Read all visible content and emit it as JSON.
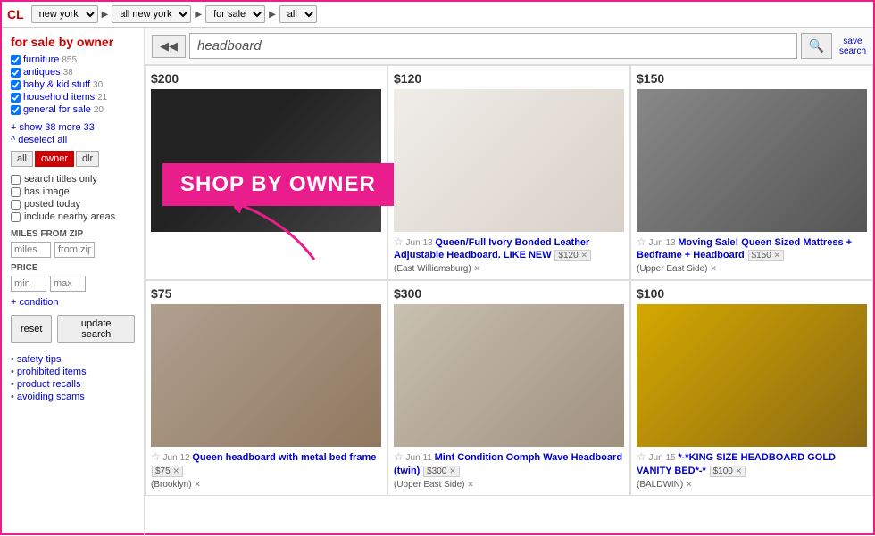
{
  "nav": {
    "logo": "CL",
    "city": "new york",
    "region": "all new york",
    "category": "for sale",
    "subcategory": "all"
  },
  "sidebar": {
    "title": "for sale by owner",
    "categories": [
      {
        "label": "furniture",
        "count": "855",
        "checked": true
      },
      {
        "label": "antiques",
        "count": "38",
        "checked": true
      },
      {
        "label": "baby & kid stuff",
        "count": "30",
        "checked": true
      },
      {
        "label": "household items",
        "count": "21",
        "checked": true
      },
      {
        "label": "general for sale",
        "count": "20",
        "checked": true
      }
    ],
    "show_more": "+ show 38 more 33",
    "deselect": "^ deselect all",
    "filter_tabs": [
      "all",
      "owner",
      "dlr"
    ],
    "active_tab": "owner",
    "filter_options": [
      {
        "label": "search titles only",
        "checked": false
      },
      {
        "label": "has image",
        "checked": false
      },
      {
        "label": "posted today",
        "checked": false
      },
      {
        "label": "include nearby areas",
        "checked": false
      }
    ],
    "miles_label": "MILES FROM ZIP",
    "miles_placeholder": "miles",
    "zip_placeholder": "from zip",
    "price_label": "PRICE",
    "price_min": "min",
    "price_max": "max",
    "condition_toggle": "+ condition",
    "btn_reset": "reset",
    "btn_update": "update search",
    "links": [
      "safety tips",
      "prohibited items",
      "product recalls",
      "avoiding scams"
    ]
  },
  "search": {
    "back_btn": "◀◀",
    "query": "headboard",
    "search_btn": "🔍",
    "save_label": "save",
    "search_label": "search"
  },
  "listings": [
    {
      "price": "$200",
      "img_class": "img-dark",
      "date": "",
      "title": "",
      "location": "",
      "tags": []
    },
    {
      "price": "$120",
      "img_class": "img-white",
      "date": "Jun 13",
      "title": "Queen/Full Ivory Bonded Leather Adjustable Headboard. LIKE NEW",
      "price_tag": "$120",
      "location": "East Williamsburg",
      "tags": []
    },
    {
      "price": "$150",
      "img_class": "img-gray",
      "date": "Jun 13",
      "title": "Moving Sale! Queen Sized Mattress + Bedframe + Headboard",
      "price_tag": "$150",
      "location": "Upper East Side",
      "tags": []
    },
    {
      "price": "$75",
      "img_class": "img-dog",
      "date": "Jun 12",
      "title": "Queen headboard with metal bed frame",
      "price_tag": "$75",
      "location": "Brooklyn",
      "tags": []
    },
    {
      "price": "$300",
      "img_class": "img-room",
      "date": "Jun 11",
      "title": "Mint Condition Oomph Wave Headboard (twin)",
      "price_tag": "$300",
      "location": "Upper East Side",
      "tags": []
    },
    {
      "price": "$100",
      "img_class": "img-gold",
      "date": "Jun 15",
      "title": "*-*KING SIZE HEADBOARD GOLD VANITY BED*-*",
      "price_tag": "$100",
      "location": "BALDWIN",
      "tags": []
    }
  ],
  "overlay": {
    "text": "SHOP BY OWNER"
  }
}
